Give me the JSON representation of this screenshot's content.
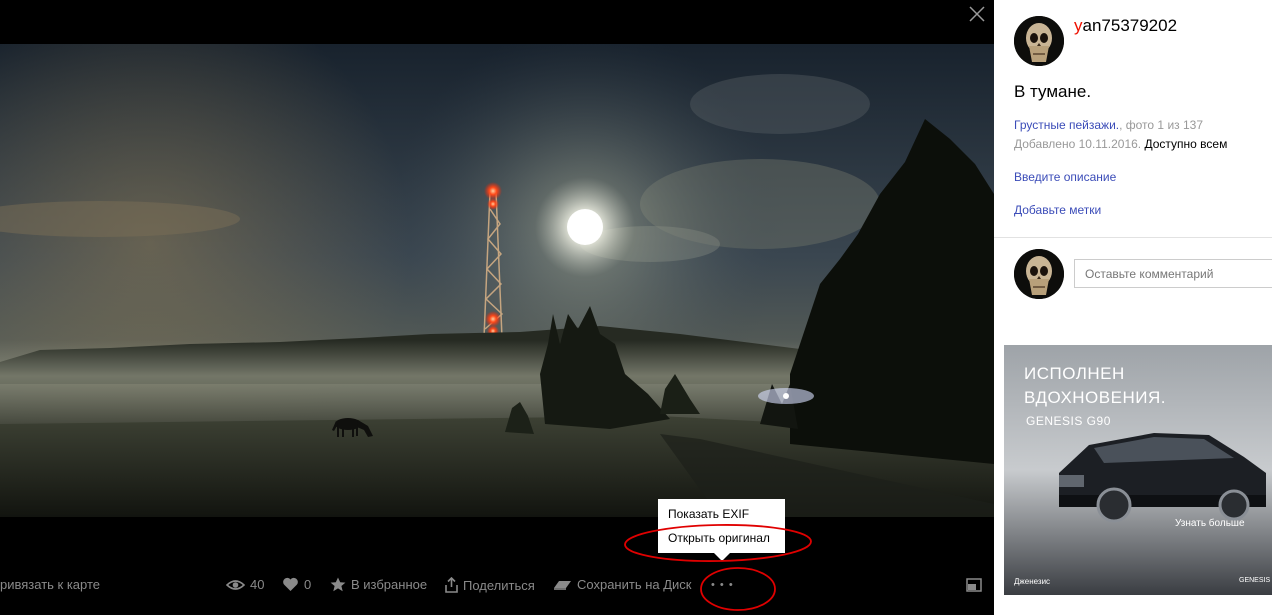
{
  "viewer": {
    "toolbar": {
      "map_label": "ривязать к карте",
      "views_count": "40",
      "likes_count": "0",
      "favorite_label": "В избранное",
      "share_label": "Поделиться",
      "save_label": "Сохранить на Диск",
      "more_label": "• • •"
    },
    "context_menu": {
      "items": [
        "Показать EXIF",
        "Открыть оригинал"
      ]
    }
  },
  "sidebar": {
    "username_first": "y",
    "username_rest": "an75379202",
    "photo_title": "В тумане.",
    "album_link": "Грустные пейзажи.",
    "photo_position": ", фото 1 из 137",
    "added_label": "Добавлено 10.11.2016.",
    "access_label": "Доступно всем",
    "add_description": "Введите описание",
    "add_tags": "Добавьте метки",
    "comment_placeholder": "Оставьте комментарий"
  },
  "ad": {
    "line1": "ИСПОЛНЕН",
    "line2": "ВДОХНОВЕНИЯ.",
    "model": "GENESIS G90",
    "cta": "Узнать больше",
    "advertiser": "Дженезис",
    "brand": "GENESIS"
  },
  "colors": {
    "link": "#3b4cb8",
    "username_accent": "#e10000",
    "annotation": "#e00000"
  },
  "icons": [
    "close-icon",
    "eye-icon",
    "heart-icon",
    "star-icon",
    "share-icon",
    "disk-icon",
    "fullscreen-icon"
  ]
}
